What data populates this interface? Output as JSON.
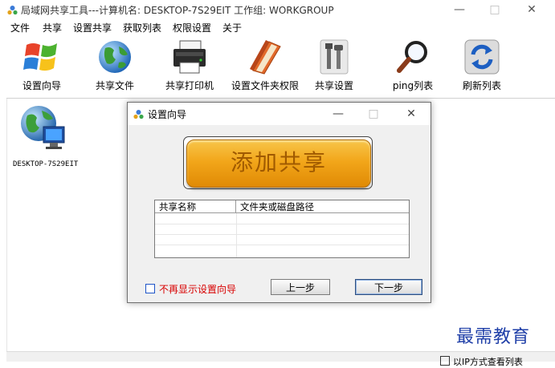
{
  "window": {
    "title": "局域网共享工具---计算机名: DESKTOP-7S29EIT  工作组: WORKGROUP",
    "controls": {
      "minimize": "—",
      "maximize": "□",
      "close": "✕"
    }
  },
  "menu": [
    "文件",
    "共享",
    "设置共享",
    "获取列表",
    "权限设置",
    "关于"
  ],
  "toolbar": [
    {
      "label": "设置向导",
      "icon": "windows-flag-icon"
    },
    {
      "label": "共享文件",
      "icon": "globe-icon"
    },
    {
      "label": "共享打印机",
      "icon": "printer-icon"
    },
    {
      "label": "设置文件夹权限",
      "icon": "folder-book-icon"
    },
    {
      "label": "共享设置",
      "icon": "tools-icon"
    },
    {
      "label": "ping列表",
      "icon": "magnifier-icon"
    },
    {
      "label": "刷新列表",
      "icon": "refresh-icon"
    }
  ],
  "computers": [
    {
      "name": "DESKTOP-7S29EIT",
      "icon": "network-computer-icon"
    }
  ],
  "dialog": {
    "title": "设置向导",
    "controls": {
      "minimize": "—",
      "maximize": "□",
      "close": "✕"
    },
    "add_share_label": "添加共享",
    "table": {
      "headers": [
        "共享名称",
        "文件夹或磁盘路径"
      ],
      "rows": []
    },
    "dont_show_label": "不再显示设置向导",
    "prev_label": "上一步",
    "next_label": "下一步"
  },
  "watermark": "最需教育",
  "bottom_checkbox_label": "以IP方式查看列表",
  "colors": {
    "accent": "#f2a61a",
    "watermark": "#1f3fa8",
    "warning_text": "#d80000"
  }
}
